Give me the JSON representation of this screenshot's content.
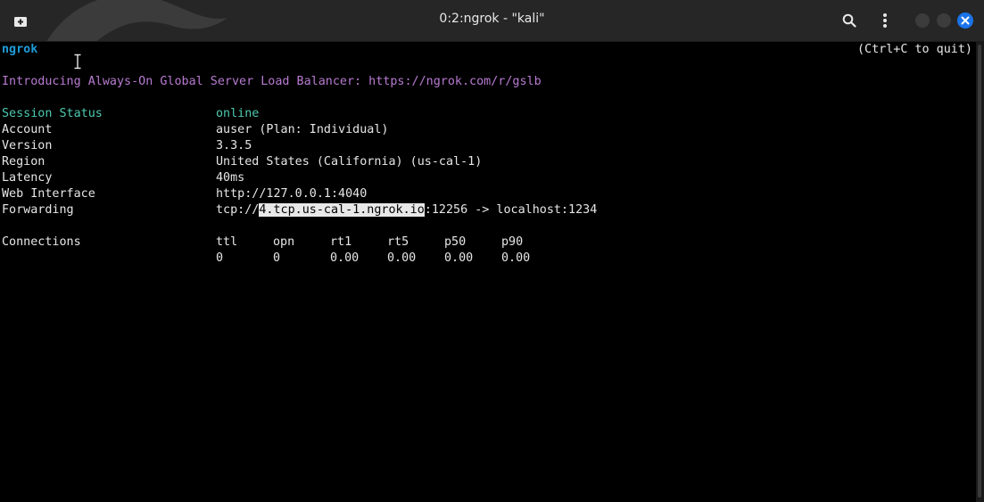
{
  "window": {
    "title": "0:2:ngrok - \"kali\""
  },
  "terminal": {
    "app_name": "ngrok",
    "quit_hint": "(Ctrl+C to quit)",
    "announcement": "Introducing Always-On Global Server Load Balancer: https://ngrok.com/r/gslb",
    "status": {
      "session_status_label": "Session Status",
      "session_status_value": "online",
      "account_label": "Account",
      "account_value": "auser (Plan: Individual)",
      "version_label": "Version",
      "version_value": "3.3.5",
      "region_label": "Region",
      "region_value": "United States (California) (us-cal-1)",
      "latency_label": "Latency",
      "latency_value": "40ms",
      "web_interface_label": "Web Interface",
      "web_interface_value": "http://127.0.0.1:4040",
      "forwarding_label": "Forwarding",
      "forwarding_prefix": "tcp://",
      "forwarding_host": "4.tcp.us-cal-1.ngrok.io",
      "forwarding_suffix": ":12256 -> localhost:1234"
    },
    "connections": {
      "label": "Connections",
      "headers": [
        "ttl",
        "opn",
        "rt1",
        "rt5",
        "p50",
        "p90"
      ],
      "values": [
        "0",
        "0",
        "0.00",
        "0.00",
        "0.00",
        "0.00"
      ]
    }
  },
  "colors": {
    "accent_cyan": "#1e9bd7",
    "announcement_purple": "#b77bd0",
    "online_teal": "#4ec9b0",
    "close_button_blue": "#1a73e8"
  },
  "icons": [
    "new-tab-icon",
    "search-icon",
    "kebab-menu-icon",
    "minimize-icon",
    "maximize-icon",
    "close-icon",
    "text-cursor-icon",
    "kali-dragon-logo"
  ]
}
